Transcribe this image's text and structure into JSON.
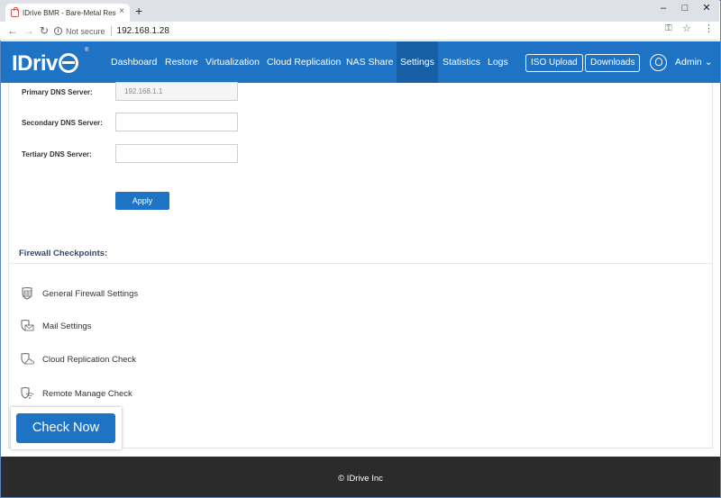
{
  "browser": {
    "tab_title": "IDrive BMR - Bare-Metal Restore",
    "tab_close": "×",
    "new_tab": "+",
    "not_secure": "Not secure",
    "url": "192.168.1.28",
    "window_controls": {
      "minimize": "–",
      "maximize": "□",
      "close": "✕"
    }
  },
  "nav": {
    "logo": "IDriv",
    "logo_reg": "®",
    "items": [
      {
        "label": "Dashboard",
        "active": false
      },
      {
        "label": "Restore",
        "active": false
      },
      {
        "label": "Virtualization",
        "active": false
      },
      {
        "label": "Cloud Replication",
        "active": false
      },
      {
        "label": "NAS Share",
        "active": false
      },
      {
        "label": "Settings",
        "active": true
      },
      {
        "label": "Statistics",
        "active": false
      },
      {
        "label": "Logs",
        "active": false
      }
    ],
    "iso_upload": "ISO Upload",
    "downloads": "Downloads",
    "admin": "Admin",
    "admin_caret": "⌄"
  },
  "dns": {
    "primary_label": "Primary DNS Server:",
    "primary_value": "192.168.1.1",
    "secondary_label": "Secondary DNS Server:",
    "secondary_value": "",
    "tertiary_label": "Tertiary DNS Server:",
    "tertiary_value": "",
    "apply_label": "Apply"
  },
  "firewall": {
    "title": "Firewall Checkpoints:",
    "items": [
      {
        "label": "General Firewall Settings",
        "icon": "firewall-shield-icon"
      },
      {
        "label": "Mail Settings",
        "icon": "mail-shield-icon"
      },
      {
        "label": "Cloud Replication Check",
        "icon": "cloud-shield-icon"
      },
      {
        "label": "Remote Manage Check",
        "icon": "wifi-shield-icon"
      }
    ],
    "check_now_label": "Check Now"
  },
  "footer": {
    "text": "© IDrive Inc"
  },
  "colors": {
    "brand_blue": "#1f73c5",
    "active_nav": "#175fa5",
    "footer_bg": "#2b2b2b"
  }
}
